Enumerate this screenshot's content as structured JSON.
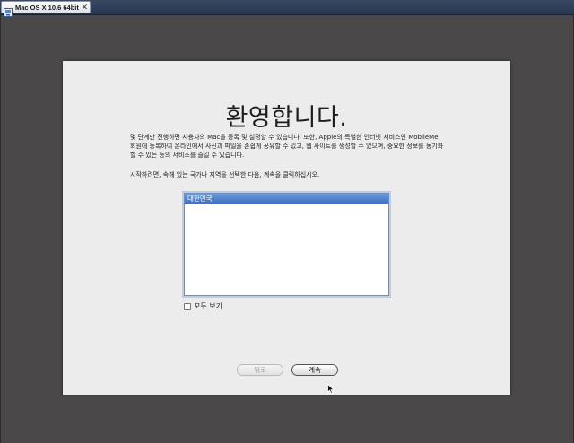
{
  "vm_tab": {
    "title": "Mac OS X 10.6 64bit",
    "close": "✕",
    "icon": "vm-icon"
  },
  "welcome": {
    "title": "환영합니다.",
    "paragraph1": "몇 단계만 진행하면 사용자의 Mac을 등록 및 설정할 수 있습니다. 또한, Apple의 특별한 인터넷 서비스인 MobileMe 회원에 등록하여 온라인에서 사진과 파일을 손쉽게 공유할 수 있고, 웹 사이트를 생성할 수 있으며, 중요한 정보를 동기화할 수 있는 등의 서비스를 즐길 수 있습니다.",
    "paragraph2": "시작하려면, 속해 있는 국가나 지역을 선택한 다음, 계속을 클릭하십시오."
  },
  "country_list": {
    "items": [
      "대한민국"
    ],
    "selected": "대한민국"
  },
  "show_all": {
    "label": "모두 보기",
    "checked": false
  },
  "buttons": {
    "back": "뒤로",
    "continue": "계속"
  },
  "colors": {
    "desktop": "#4a4848",
    "panel": "#ececec",
    "selection": "#3f6fbf",
    "focus_ring": "#b7cdec"
  }
}
